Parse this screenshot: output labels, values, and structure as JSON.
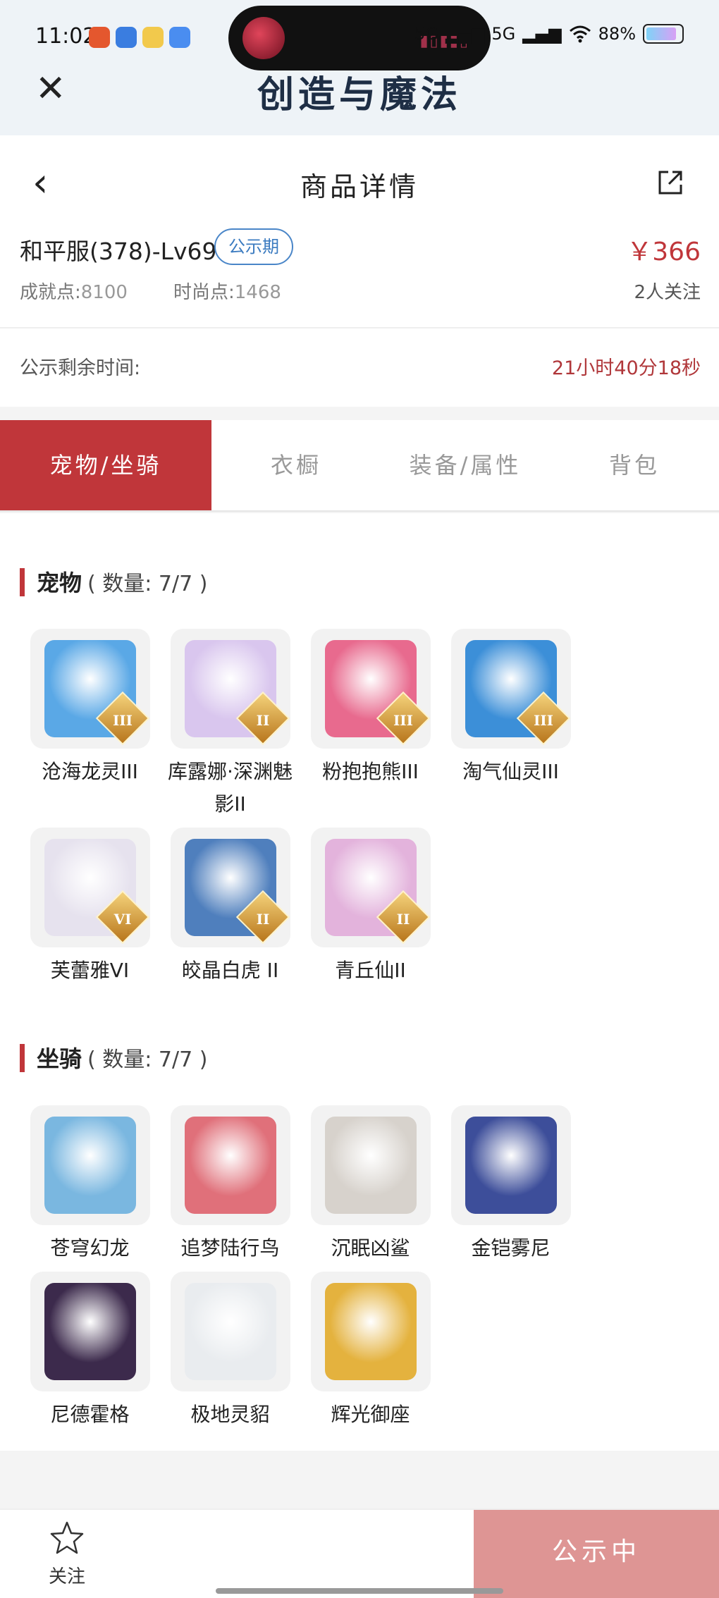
{
  "status_bar": {
    "time": "11:02",
    "signal_1": "5G",
    "signal_2": "5G",
    "battery": "88%"
  },
  "app": {
    "title": "创造与魔法"
  },
  "nav": {
    "title": "商品详情",
    "back_icon": "chevron-left-icon",
    "share_icon": "share-external-icon"
  },
  "product": {
    "name": "和平服(378)-Lv69",
    "tag": "公示期",
    "price": "￥366",
    "achievement_label": "成就点:",
    "achievement_value": "8100",
    "fashion_label": "时尚点:",
    "fashion_value": "1468",
    "followers": "2人关注",
    "remaining_label": "公示剩余时间:",
    "remaining_value": "21小时40分18秒"
  },
  "tabs": [
    {
      "label": "宠物/坐骑",
      "active": true
    },
    {
      "label": "衣橱",
      "active": false
    },
    {
      "label": "装备/属性",
      "active": false
    },
    {
      "label": "背包",
      "active": false
    }
  ],
  "pets": {
    "title": "宠物",
    "count": "( 数量: 7/7 )",
    "items": [
      {
        "name": "沧海龙灵III",
        "badge": "III",
        "color": "#5aa8e6"
      },
      {
        "name": "库露娜·深渊魅影II",
        "badge": "II",
        "color": "#d9c6ee"
      },
      {
        "name": "粉抱抱熊III",
        "badge": "III",
        "color": "#e86a8e"
      },
      {
        "name": "淘气仙灵III",
        "badge": "III",
        "color": "#3c8fd8"
      },
      {
        "name": "芙蕾雅VI",
        "badge": "VI",
        "color": "#e6e2ee"
      },
      {
        "name": "皎晶白虎 II",
        "badge": "II",
        "color": "#4f7fbd"
      },
      {
        "name": "青丘仙II",
        "badge": "II",
        "color": "#e3b3dc"
      }
    ]
  },
  "mounts": {
    "title": "坐骑",
    "count": "( 数量: 7/7 )",
    "items": [
      {
        "name": "苍穹幻龙",
        "color": "#7ab7e0"
      },
      {
        "name": "追梦陆行鸟",
        "color": "#e0707a"
      },
      {
        "name": "沉眠凶鲨",
        "color": "#d7d2cc"
      },
      {
        "name": "金铠雾尼",
        "color": "#3d4e9a"
      },
      {
        "name": "尼德霍格",
        "color": "#3c2a4c"
      },
      {
        "name": "极地灵貂",
        "color": "#e9ecef"
      },
      {
        "name": "辉光御座",
        "color": "#e4b23e"
      }
    ]
  },
  "bottom": {
    "follow_label": "关注",
    "status_button": "公示中"
  }
}
